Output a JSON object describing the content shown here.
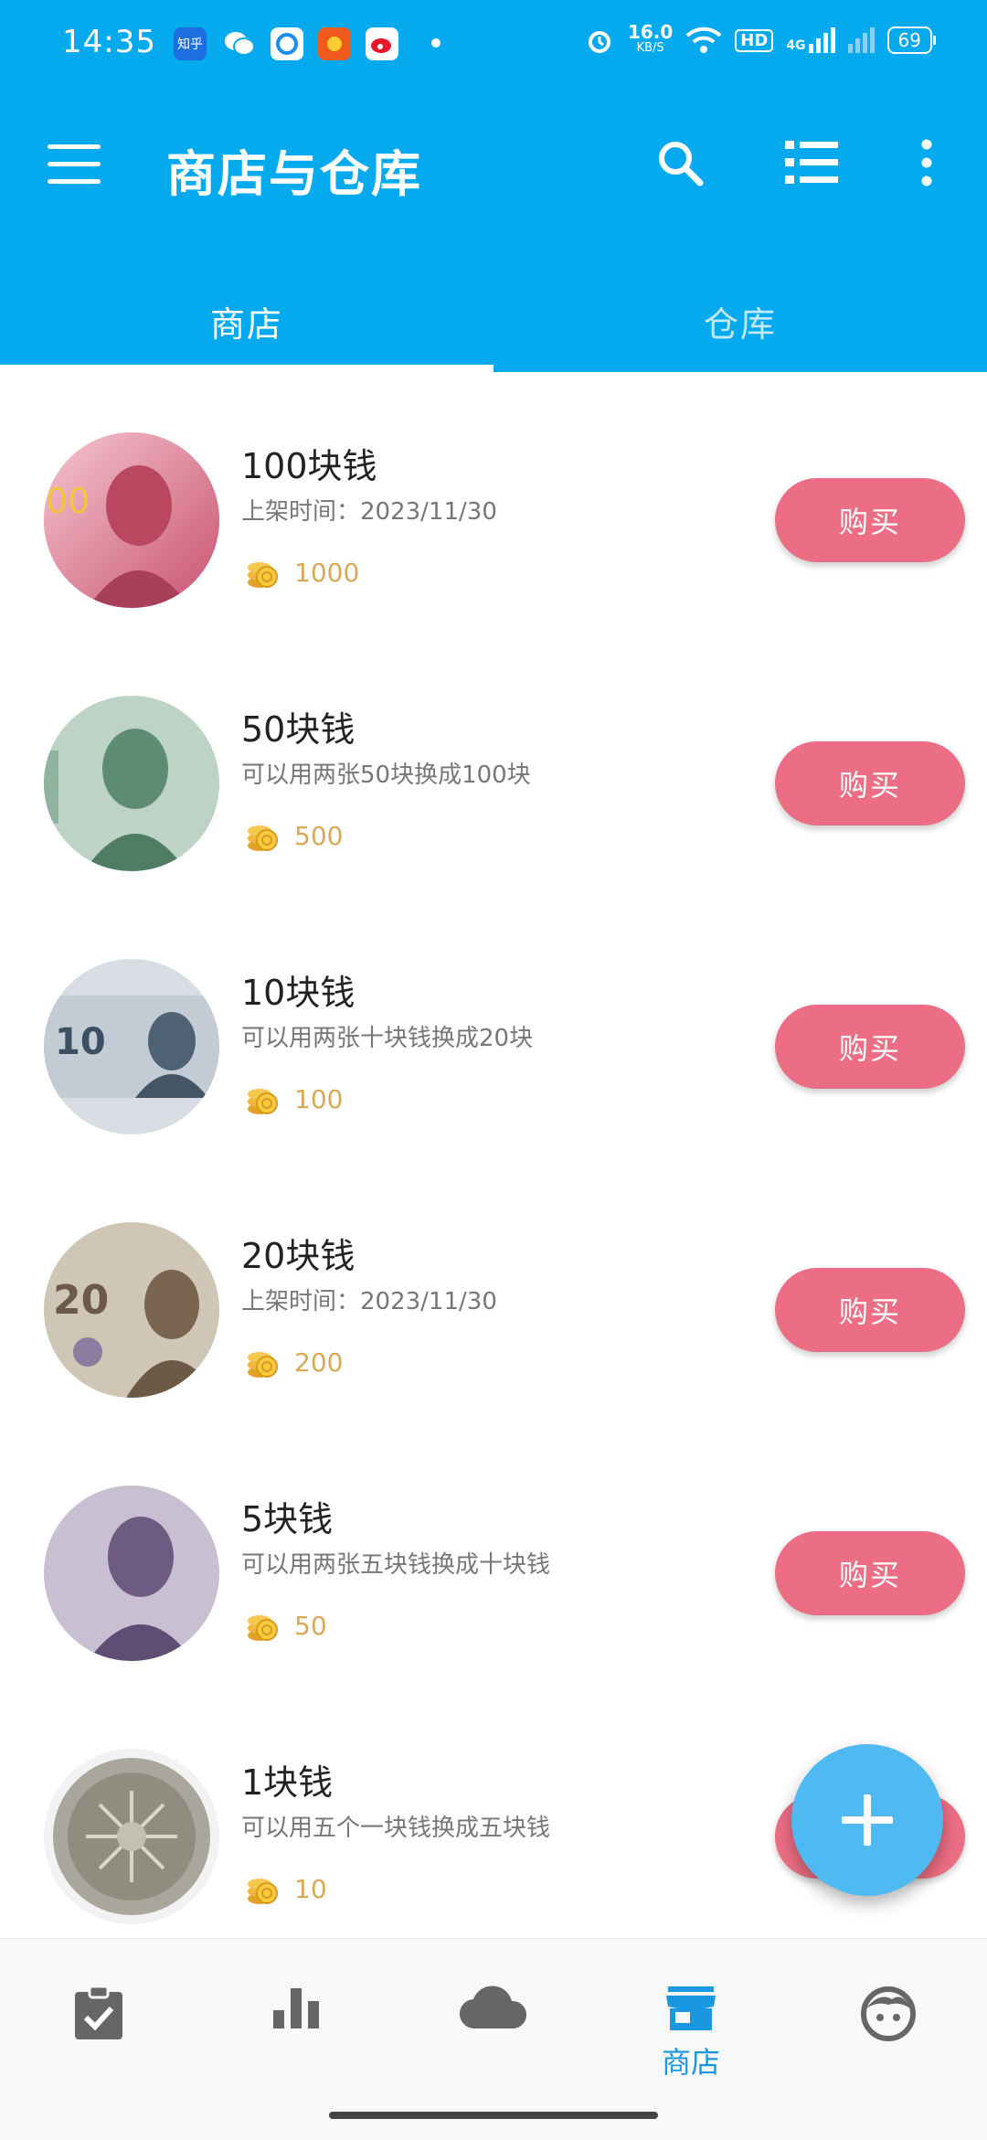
{
  "status_bar": {
    "time": "14:35",
    "apps": [
      "知乎",
      "wechat",
      "qq-browser",
      "taobao",
      "weibo"
    ],
    "speed": "16.0\nKB/S",
    "speed_value": "16.0",
    "speed_unit": "KB/S",
    "network": "4G",
    "hd": "HD",
    "battery": "69"
  },
  "app_bar": {
    "title": "商店与仓库",
    "icons": [
      "menu-icon",
      "search-icon",
      "list-icon",
      "more-vert-icon"
    ]
  },
  "tabs": [
    {
      "label": "商店",
      "active": true
    },
    {
      "label": "仓库",
      "active": false
    }
  ],
  "items": [
    {
      "name": "100块钱",
      "desc": "上架时间：2023/11/30",
      "price": "1000",
      "buy_label": "购买",
      "thumb_color": "#d86a86"
    },
    {
      "name": "50块钱",
      "desc": "可以用两张50块换成100块",
      "price": "500",
      "buy_label": "购买",
      "thumb_color": "#7fa98f"
    },
    {
      "name": "10块钱",
      "desc": "可以用两张十块钱换成20块",
      "price": "100",
      "buy_label": "购买",
      "thumb_color": "#8aa0b4"
    },
    {
      "name": "20块钱",
      "desc": "上架时间：2023/11/30",
      "price": "200",
      "buy_label": "购买",
      "thumb_color": "#a89a84"
    },
    {
      "name": "5块钱",
      "desc": "可以用两张五块钱换成十块钱",
      "price": "50",
      "buy_label": "购买",
      "thumb_color": "#9a8aa8"
    },
    {
      "name": "1块钱",
      "desc": "可以用五个一块钱换成五块钱",
      "price": "10",
      "buy_label": "购买",
      "thumb_color": "#9c9a90"
    }
  ],
  "fab": {
    "icon": "plus-icon"
  },
  "bottom_nav": [
    {
      "icon": "task-check-icon",
      "label": ""
    },
    {
      "icon": "bar-chart-icon",
      "label": ""
    },
    {
      "icon": "cloud-icon",
      "label": ""
    },
    {
      "icon": "store-icon",
      "label": "商店",
      "active": true
    },
    {
      "icon": "face-icon",
      "label": ""
    }
  ],
  "colors": {
    "primary": "#04a9ee",
    "buy": "#ec6e84",
    "price": "#d9a957",
    "fab": "#4fb9f2",
    "nav_active": "#1997e0"
  }
}
